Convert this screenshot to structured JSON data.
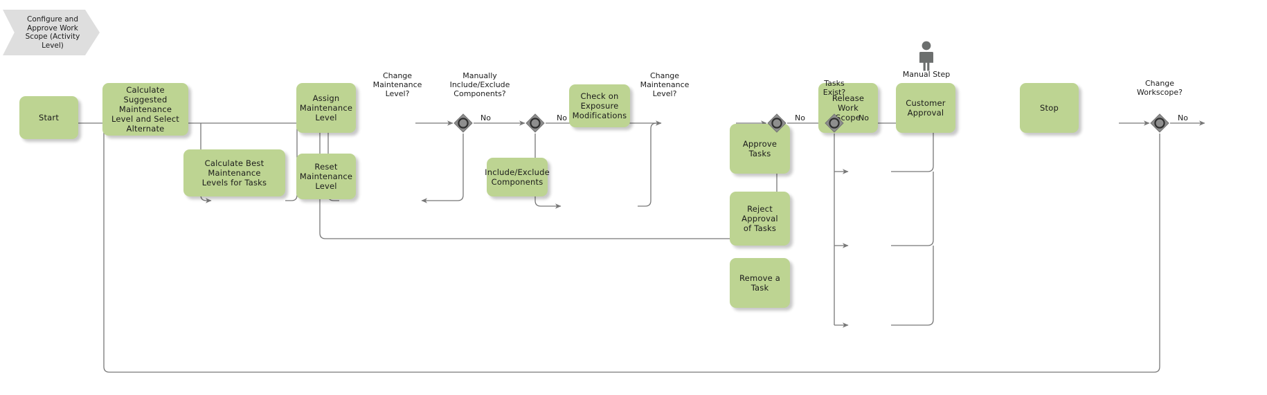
{
  "diagram": {
    "title": "Configure and Approve Work Scope (Activity Level)",
    "banner_label": "Configure and\nApprove Work\nScope (Activity\nLevel)",
    "colors": {
      "task_fill": "#bdd492",
      "banner_fill": "#dedede",
      "gateway_fill": "#888888",
      "gateway_stroke": "#333333",
      "connector": "#777777",
      "text": "#1a1a1a"
    }
  },
  "tasks": [
    {
      "id": "start",
      "label": "Start"
    },
    {
      "id": "calc-suggested",
      "label": "Calculate\nSuggested\nMaintenance\nLevel and Select\nAlternate"
    },
    {
      "id": "calc-best",
      "label": "Calculate Best\nMaintenance\nLevels for Tasks"
    },
    {
      "id": "assign-level",
      "label": "Assign\nMaintenance\nLevel"
    },
    {
      "id": "reset-level",
      "label": "Reset\nMaintenance\nLevel"
    },
    {
      "id": "include-exclude",
      "label": "Include/Exclude\nComponents"
    },
    {
      "id": "check-exposure",
      "label": "Check on\nExposure\nModifications"
    },
    {
      "id": "approve-tasks",
      "label": "Approve Tasks"
    },
    {
      "id": "reject-approval",
      "label": "Reject Approval\nof Tasks"
    },
    {
      "id": "remove-task",
      "label": "Remove a Task"
    },
    {
      "id": "release-scope",
      "label": "Release Work\nScope"
    },
    {
      "id": "customer-approval",
      "label": "Customer\nApproval"
    },
    {
      "id": "stop",
      "label": "Stop"
    }
  ],
  "gateways": [
    {
      "id": "gw-change-level-1",
      "label": "Change\nMaintenance\nLevel?"
    },
    {
      "id": "gw-include-exclude",
      "label": "Manually\nInclude/Exclude\nComponents?"
    },
    {
      "id": "gw-change-level-2",
      "label": "Change\nMaintenance\nLevel?"
    },
    {
      "id": "gw-tasks-exist",
      "label": "Tasks\nExist?"
    },
    {
      "id": "gw-change-workscope",
      "label": "Change\nWorkscope?"
    }
  ],
  "flow_labels": [
    {
      "id": "no-1",
      "label": "No"
    },
    {
      "id": "no-2",
      "label": "No"
    },
    {
      "id": "no-3",
      "label": "No"
    },
    {
      "id": "no-4",
      "label": "No"
    },
    {
      "id": "no-5",
      "label": "No"
    }
  ],
  "markers": [
    {
      "id": "manual-step",
      "label": "Manual Step",
      "icon": "person-icon"
    }
  ]
}
